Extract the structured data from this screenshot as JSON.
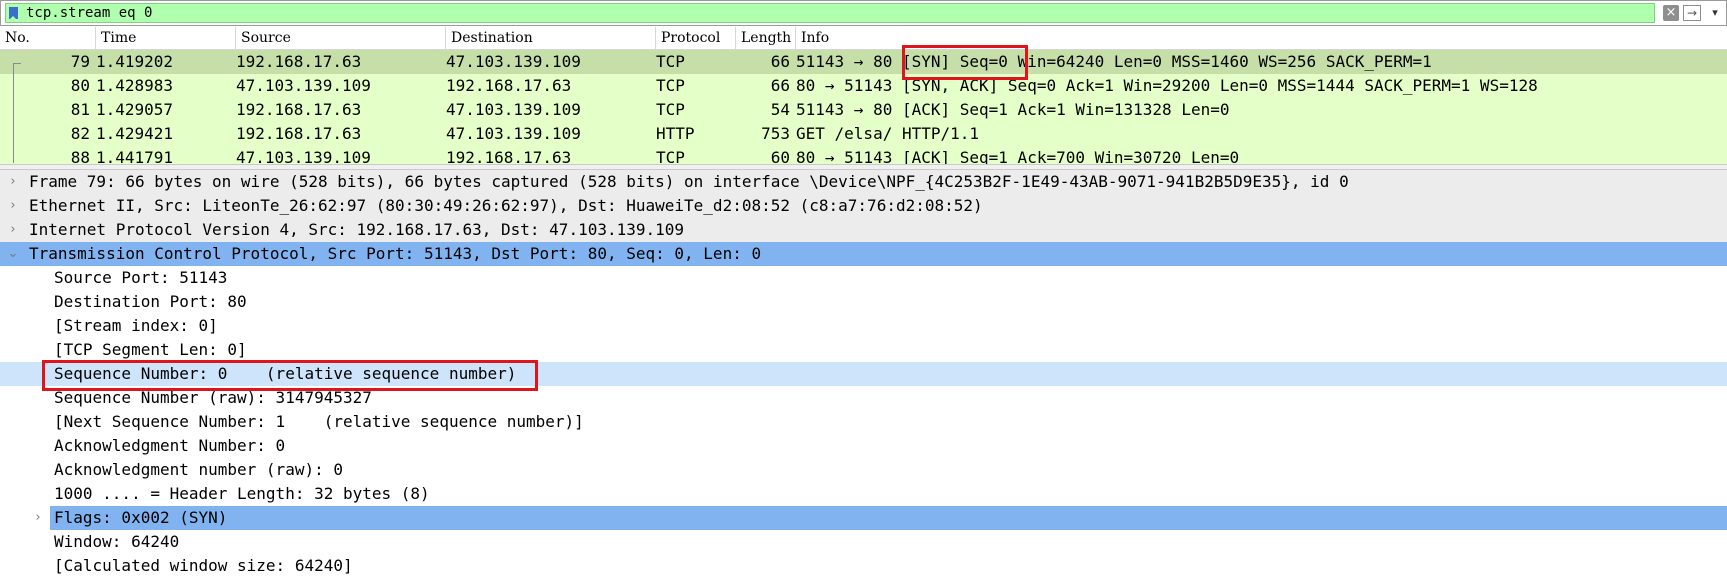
{
  "filter": {
    "value": "tcp.stream eq 0",
    "clear_icon": "x-icon",
    "apply_icon": "arrow-right-icon",
    "dropdown_icon": "chevron-down-icon"
  },
  "packet_list": {
    "columns": [
      "No.",
      "Time",
      "Source",
      "Destination",
      "Protocol",
      "Length",
      "Info"
    ],
    "rows": [
      {
        "no": "79",
        "time": "1.419202",
        "source": "192.168.17.63",
        "destination": "47.103.139.109",
        "protocol": "TCP",
        "length": "66",
        "info_pre": "51143 → 80 ",
        "info_hl": "[SYN] Seq=0",
        "info_post": " Win=64240 Len=0 MSS=1460 WS=256 SACK_PERM=1"
      },
      {
        "no": "80",
        "time": "1.428983",
        "source": "47.103.139.109",
        "destination": "192.168.17.63",
        "protocol": "TCP",
        "length": "66",
        "info": "80 → 51143 [SYN, ACK] Seq=0 Ack=1 Win=29200 Len=0 MSS=1444 SACK_PERM=1 WS=128"
      },
      {
        "no": "81",
        "time": "1.429057",
        "source": "192.168.17.63",
        "destination": "47.103.139.109",
        "protocol": "TCP",
        "length": "54",
        "info": "51143 → 80 [ACK] Seq=1 Ack=1 Win=131328 Len=0"
      },
      {
        "no": "82",
        "time": "1.429421",
        "source": "192.168.17.63",
        "destination": "47.103.139.109",
        "protocol": "HTTP",
        "length": "753",
        "info": "GET /elsa/ HTTP/1.1"
      },
      {
        "no": "88",
        "time": "1.441791",
        "source": "47.103.139.109",
        "destination": "192.168.17.63",
        "protocol": "TCP",
        "length": "60",
        "info": "80 → 51143 [ACK] Seq=1 Ack=700 Win=30720 Len=0"
      }
    ]
  },
  "details": {
    "frame": "Frame 79: 66 bytes on wire (528 bits), 66 bytes captured (528 bits) on interface \\Device\\NPF_{4C253B2F-1E49-43AB-9071-941B2B5D9E35}, id 0",
    "ethernet": "Ethernet II, Src: LiteonTe_26:62:97 (80:30:49:26:62:97), Dst: HuaweiTe_d2:08:52 (c8:a7:76:d2:08:52)",
    "ip": "Internet Protocol Version 4, Src: 192.168.17.63, Dst: 47.103.139.109",
    "tcp": "Transmission Control Protocol, Src Port: 51143, Dst Port: 80, Seq: 0, Len: 0",
    "tcp_fields": [
      "Source Port: 51143",
      "Destination Port: 80",
      "[Stream index: 0]",
      "[TCP Segment Len: 0]",
      "Sequence Number: 0    (relative sequence number)",
      "Sequence Number (raw): 3147945327",
      "[Next Sequence Number: 1    (relative sequence number)]",
      "Acknowledgment Number: 0",
      "Acknowledgment number (raw): 0",
      "1000 .... = Header Length: 32 bytes (8)",
      "Flags: 0x002 (SYN)",
      "Window: 64240",
      "[Calculated window size: 64240]"
    ]
  },
  "colors": {
    "tcp_row": "#e4ffc7",
    "selected_row": "#c6dfa9",
    "filter_bg": "#afffaf",
    "detail_selected": "#80b3f0",
    "detail_subselected": "#cde4fb",
    "annotation": "#e0141b"
  }
}
